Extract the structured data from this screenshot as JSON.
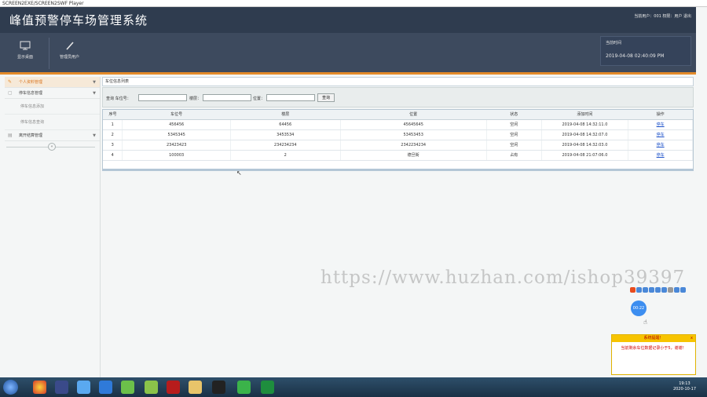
{
  "window": {
    "title": "SCREEN2EXE/SCREEN2SWF Player"
  },
  "header": {
    "title": "峰值预警停车场管理系统",
    "user_info": "当前用户：001 权限：用户 退出"
  },
  "toolbar": {
    "items": [
      {
        "label": "显示桌面",
        "icon": "monitor-icon"
      },
      {
        "label": "管理员用户",
        "icon": "pencil-icon"
      }
    ],
    "time_label": "当前时间",
    "time_value": "2019-04-08 02:40:09 PM"
  },
  "sidebar": {
    "items": [
      {
        "label": "个人资料管理",
        "active": true
      },
      {
        "label": "停车信息管理",
        "active": false
      },
      {
        "label": "停车信息添加",
        "sub": true
      },
      {
        "label": "停车信息查询",
        "sub": true
      },
      {
        "label": "离开结算管理",
        "active": false
      }
    ],
    "collapse_glyph": "«"
  },
  "panel": {
    "title": "车位信息列表"
  },
  "search": {
    "label_query": "查询 车位号：",
    "label_floor": "楼层：",
    "label_position": "位置：",
    "button": "查询"
  },
  "table": {
    "headers": [
      "序号",
      "车位号",
      "楼层",
      "位置",
      "状态",
      "添加时间",
      "操作"
    ],
    "rows": [
      [
        "1",
        "456456",
        "64456",
        "45645645",
        "空闲",
        "2019-04-08 14:32:11.0",
        "停车"
      ],
      [
        "2",
        "5345345",
        "3453534",
        "53453453",
        "空闲",
        "2019-04-08 14:32:07.0",
        "停车"
      ],
      [
        "3",
        "23423423",
        "234234234",
        "2342234234",
        "空闲",
        "2019-04-08 14:32:03.0",
        "停车"
      ],
      [
        "4",
        "100003",
        "2",
        "德旦街",
        "占有",
        "2019-04-08 21:07:06.0",
        "停车"
      ]
    ]
  },
  "overlay": {
    "watermark": "https://www.huzhan.com/ishop39397",
    "bubble": "00:22",
    "alert_title": "系统提醒！",
    "alert_body": "当前剩余车位数据记录小于5，谢谢！",
    "alert_close": "x"
  },
  "taskbar": {
    "time": "19:13",
    "date": "2020-10-17"
  }
}
